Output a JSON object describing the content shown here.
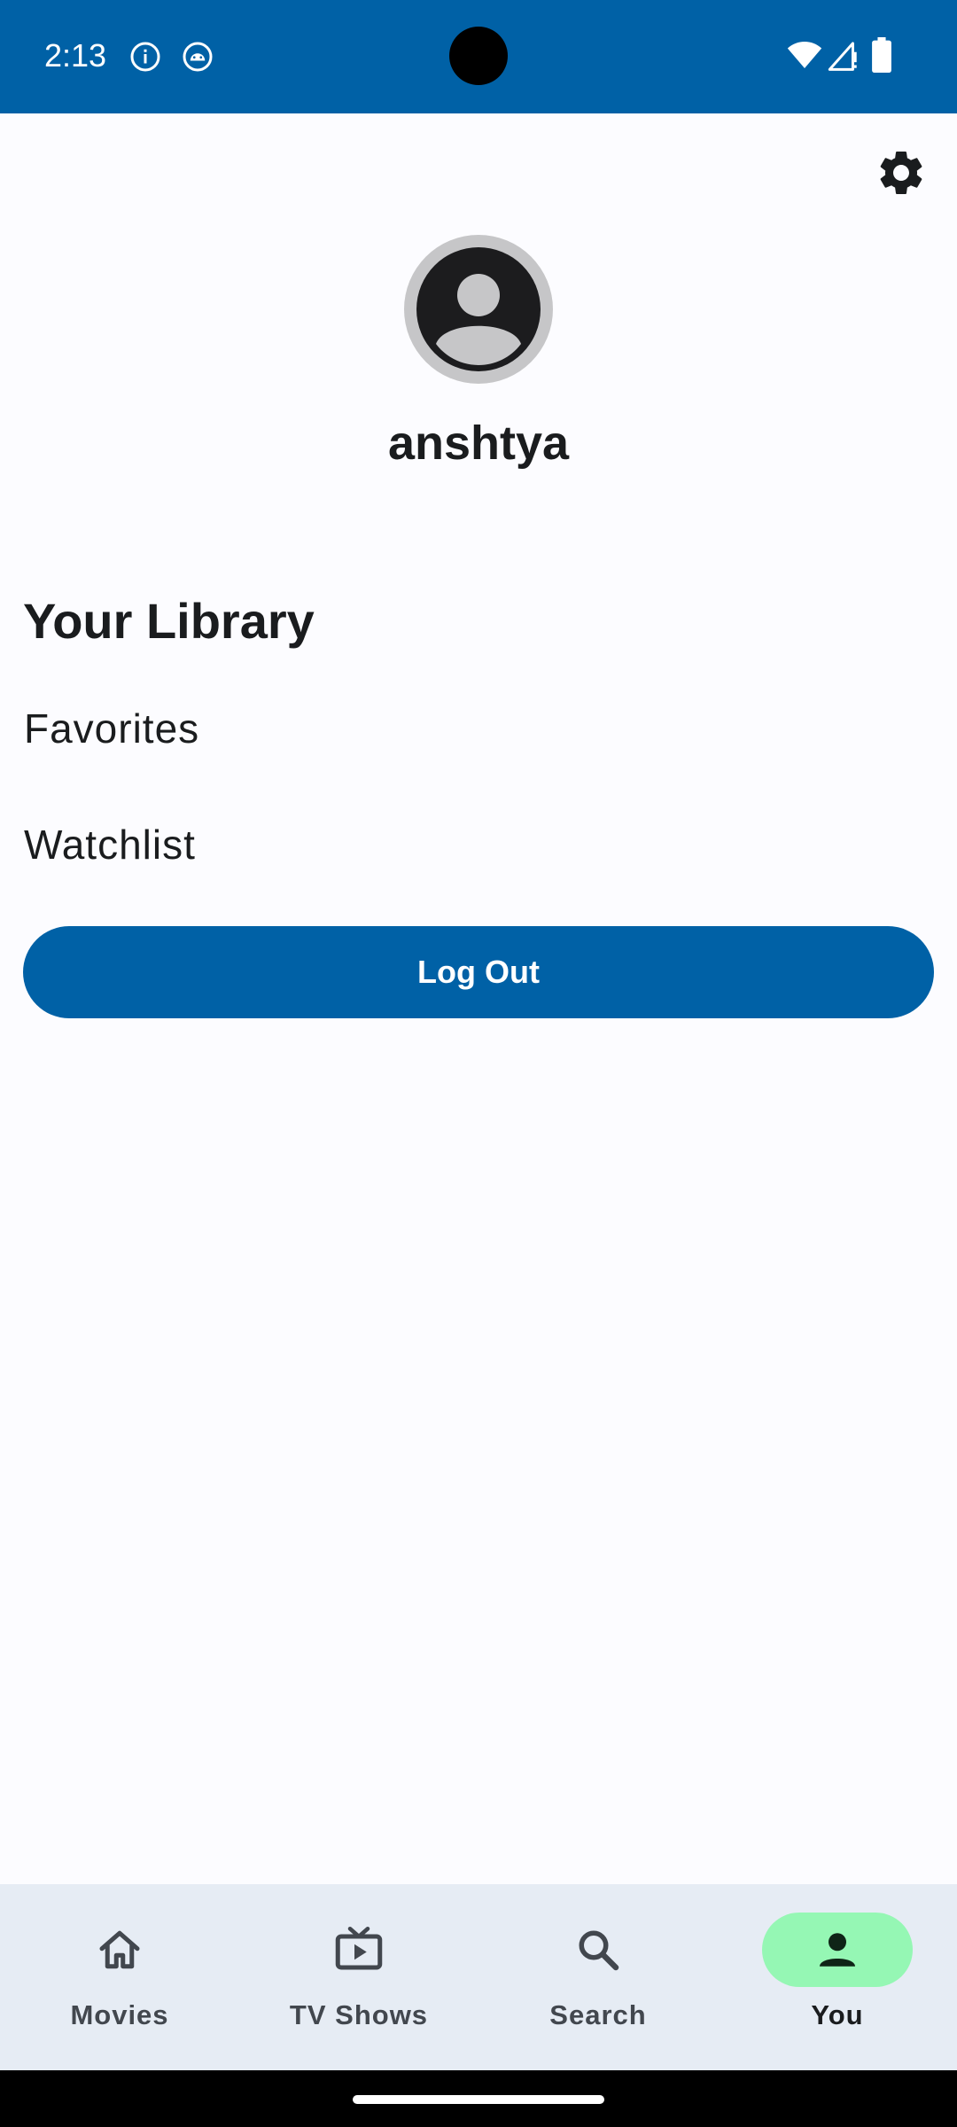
{
  "status_bar": {
    "time": "2:13",
    "left_icons": [
      "info-icon",
      "android-debug-icon"
    ],
    "right_icons": [
      "wifi-icon",
      "signal-icon",
      "battery-icon"
    ],
    "background": "#0061a6"
  },
  "header": {
    "settings_icon": "gear-icon"
  },
  "profile": {
    "avatar_icon": "account-circle-icon",
    "username": "anshtya"
  },
  "library": {
    "title": "Your Library",
    "items": [
      {
        "label": "Favorites"
      },
      {
        "label": "Watchlist"
      }
    ]
  },
  "logout": {
    "label": "Log Out",
    "color": "#0061a6"
  },
  "bottom_nav": {
    "items": [
      {
        "label": "Movies",
        "icon": "home-icon",
        "active": false
      },
      {
        "label": "TV Shows",
        "icon": "tv-icon",
        "active": false
      },
      {
        "label": "Search",
        "icon": "search-icon",
        "active": false
      },
      {
        "label": "You",
        "icon": "person-icon",
        "active": true
      }
    ],
    "active_indicator_color": "#95f7b4",
    "background": "#e6ecf4"
  }
}
